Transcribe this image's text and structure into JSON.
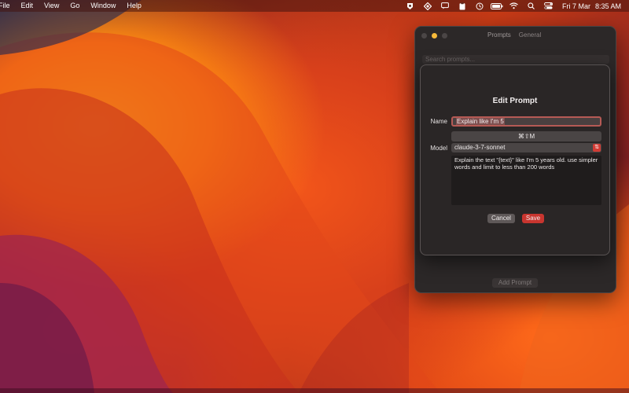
{
  "menubar": {
    "menus": [
      "File",
      "Edit",
      "View",
      "Go",
      "Window",
      "Help"
    ],
    "status_icons": [
      "shield-icon",
      "app-icon",
      "chat-icon",
      "clipboard-icon",
      "history-icon",
      "battery-icon",
      "wifi-icon",
      "search-icon",
      "control-center-icon"
    ],
    "date": "Fri 7 Mar",
    "time": "8:35 AM"
  },
  "prompts_window": {
    "tabs": [
      "Prompts",
      "General"
    ],
    "search_placeholder": "Search prompts...",
    "add_button": "Add Prompt"
  },
  "edit_sheet": {
    "title": "Edit Prompt",
    "name_label": "Name",
    "name_value": "Explain like I'm 5",
    "shortcut": "⌘⇧M",
    "model_label": "Model",
    "model_value": "claude-3-7-sonnet",
    "prompt_text": "Explain the text \"{text}\" like I'm 5 years old. use simpler words and limit to less than 200 words",
    "cancel_label": "Cancel",
    "save_label": "Save"
  },
  "colors": {
    "accent": "#c8352f",
    "focus_ring": "#b65a55",
    "window_bg": "#2c2828"
  }
}
